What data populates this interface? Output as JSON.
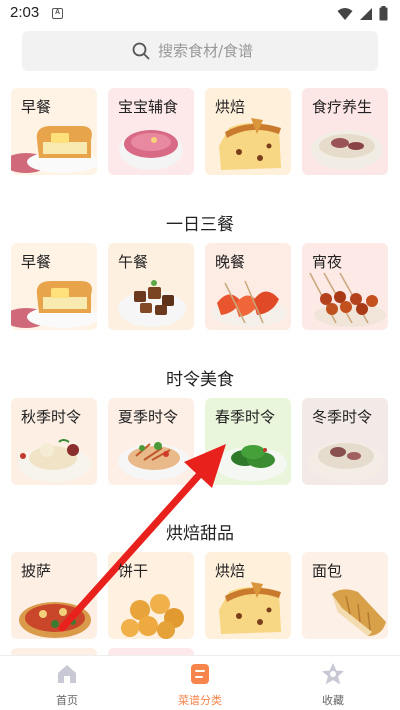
{
  "status_bar": {
    "time": "2:03",
    "a_icon": "A"
  },
  "search": {
    "placeholder": "搜索食材/食谱"
  },
  "top_grid": [
    {
      "label": "早餐",
      "bg": "#fff3e6"
    },
    {
      "label": "宝宝辅食",
      "bg": "#fde8ea"
    },
    {
      "label": "烘焙",
      "bg": "#fff0dc"
    },
    {
      "label": "食疗养生",
      "bg": "#fde6e6"
    }
  ],
  "sections": [
    {
      "title": "一日三餐",
      "items": [
        {
          "label": "早餐",
          "bg": "#fff3e6"
        },
        {
          "label": "午餐",
          "bg": "#fdf0e0"
        },
        {
          "label": "晚餐",
          "bg": "#fdece4"
        },
        {
          "label": "宵夜",
          "bg": "#fde9e6"
        }
      ]
    },
    {
      "title": "时令美食",
      "items": [
        {
          "label": "秋季时令",
          "bg": "#fdefe4"
        },
        {
          "label": "夏季时令",
          "bg": "#fdeee6"
        },
        {
          "label": "春季时令",
          "bg": "#eaf6dc"
        },
        {
          "label": "冬季时令",
          "bg": "#f3e9e6"
        }
      ]
    },
    {
      "title": "烘焙甜品",
      "items": [
        {
          "label": "披萨",
          "bg": "#fdefe4"
        },
        {
          "label": "饼干",
          "bg": "#fff0e0"
        },
        {
          "label": "烘焙",
          "bg": "#fff0dc"
        },
        {
          "label": "面包",
          "bg": "#fdf0e6"
        }
      ]
    }
  ],
  "bottom_nav": [
    {
      "label": "首页",
      "icon": "home-icon",
      "active": false
    },
    {
      "label": "菜谱分类",
      "icon": "recipe-category-icon",
      "active": true
    },
    {
      "label": "收藏",
      "icon": "favorites-icon",
      "active": false
    }
  ],
  "colors": {
    "accent": "#f7844a",
    "annotation_arrow": "#e8211c",
    "search_bg": "#f2f2f2"
  }
}
